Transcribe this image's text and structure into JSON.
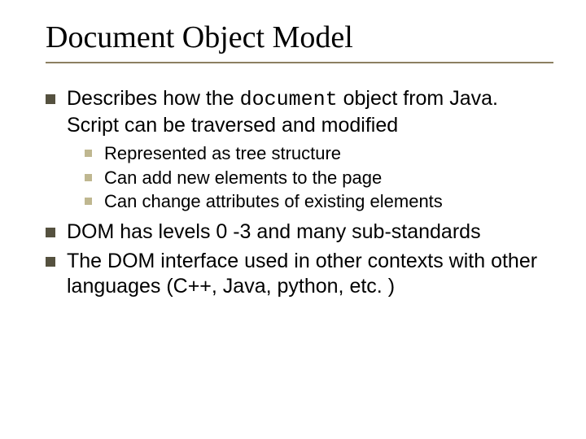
{
  "title": "Document Object Model",
  "bullets": [
    {
      "pre": "Describes how the ",
      "code": "document",
      "post": " object from Java. Script can be traversed and modified",
      "sub": [
        "Represented as tree structure",
        "Can add new elements to the page",
        "Can change attributes of existing elements"
      ]
    },
    {
      "pre": "DOM has levels 0 -3 and many sub-standards",
      "code": "",
      "post": "",
      "sub": []
    },
    {
      "pre": "The DOM interface used in other contexts with other languages (C++, Java, python, etc. )",
      "code": "",
      "post": "",
      "sub": []
    }
  ]
}
